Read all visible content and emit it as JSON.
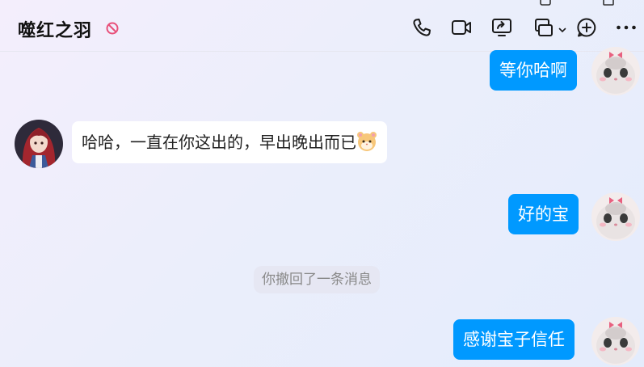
{
  "header": {
    "title": "噬红之羽",
    "icons": [
      "no-disturb-icon",
      "phone-icon",
      "video-call-icon",
      "screen-share-icon",
      "remote-control-icon",
      "chevron-down-icon",
      "add-member-icon",
      "more-icon"
    ]
  },
  "messages": [
    {
      "type": "outgoing",
      "text": "等你哈啊"
    },
    {
      "type": "incoming",
      "text": "哈哈，一直在你这出的，早出晚出而已",
      "emoji": "hamster-emoji"
    },
    {
      "type": "outgoing",
      "text": "好的宝"
    },
    {
      "type": "system",
      "text": "你撤回了一条消息"
    },
    {
      "type": "outgoing",
      "text": "感谢宝子信任"
    }
  ],
  "colors": {
    "outgoing_bubble": "#0099ff",
    "incoming_bubble": "#ffffff",
    "no_disturb": "#e8507a"
  }
}
